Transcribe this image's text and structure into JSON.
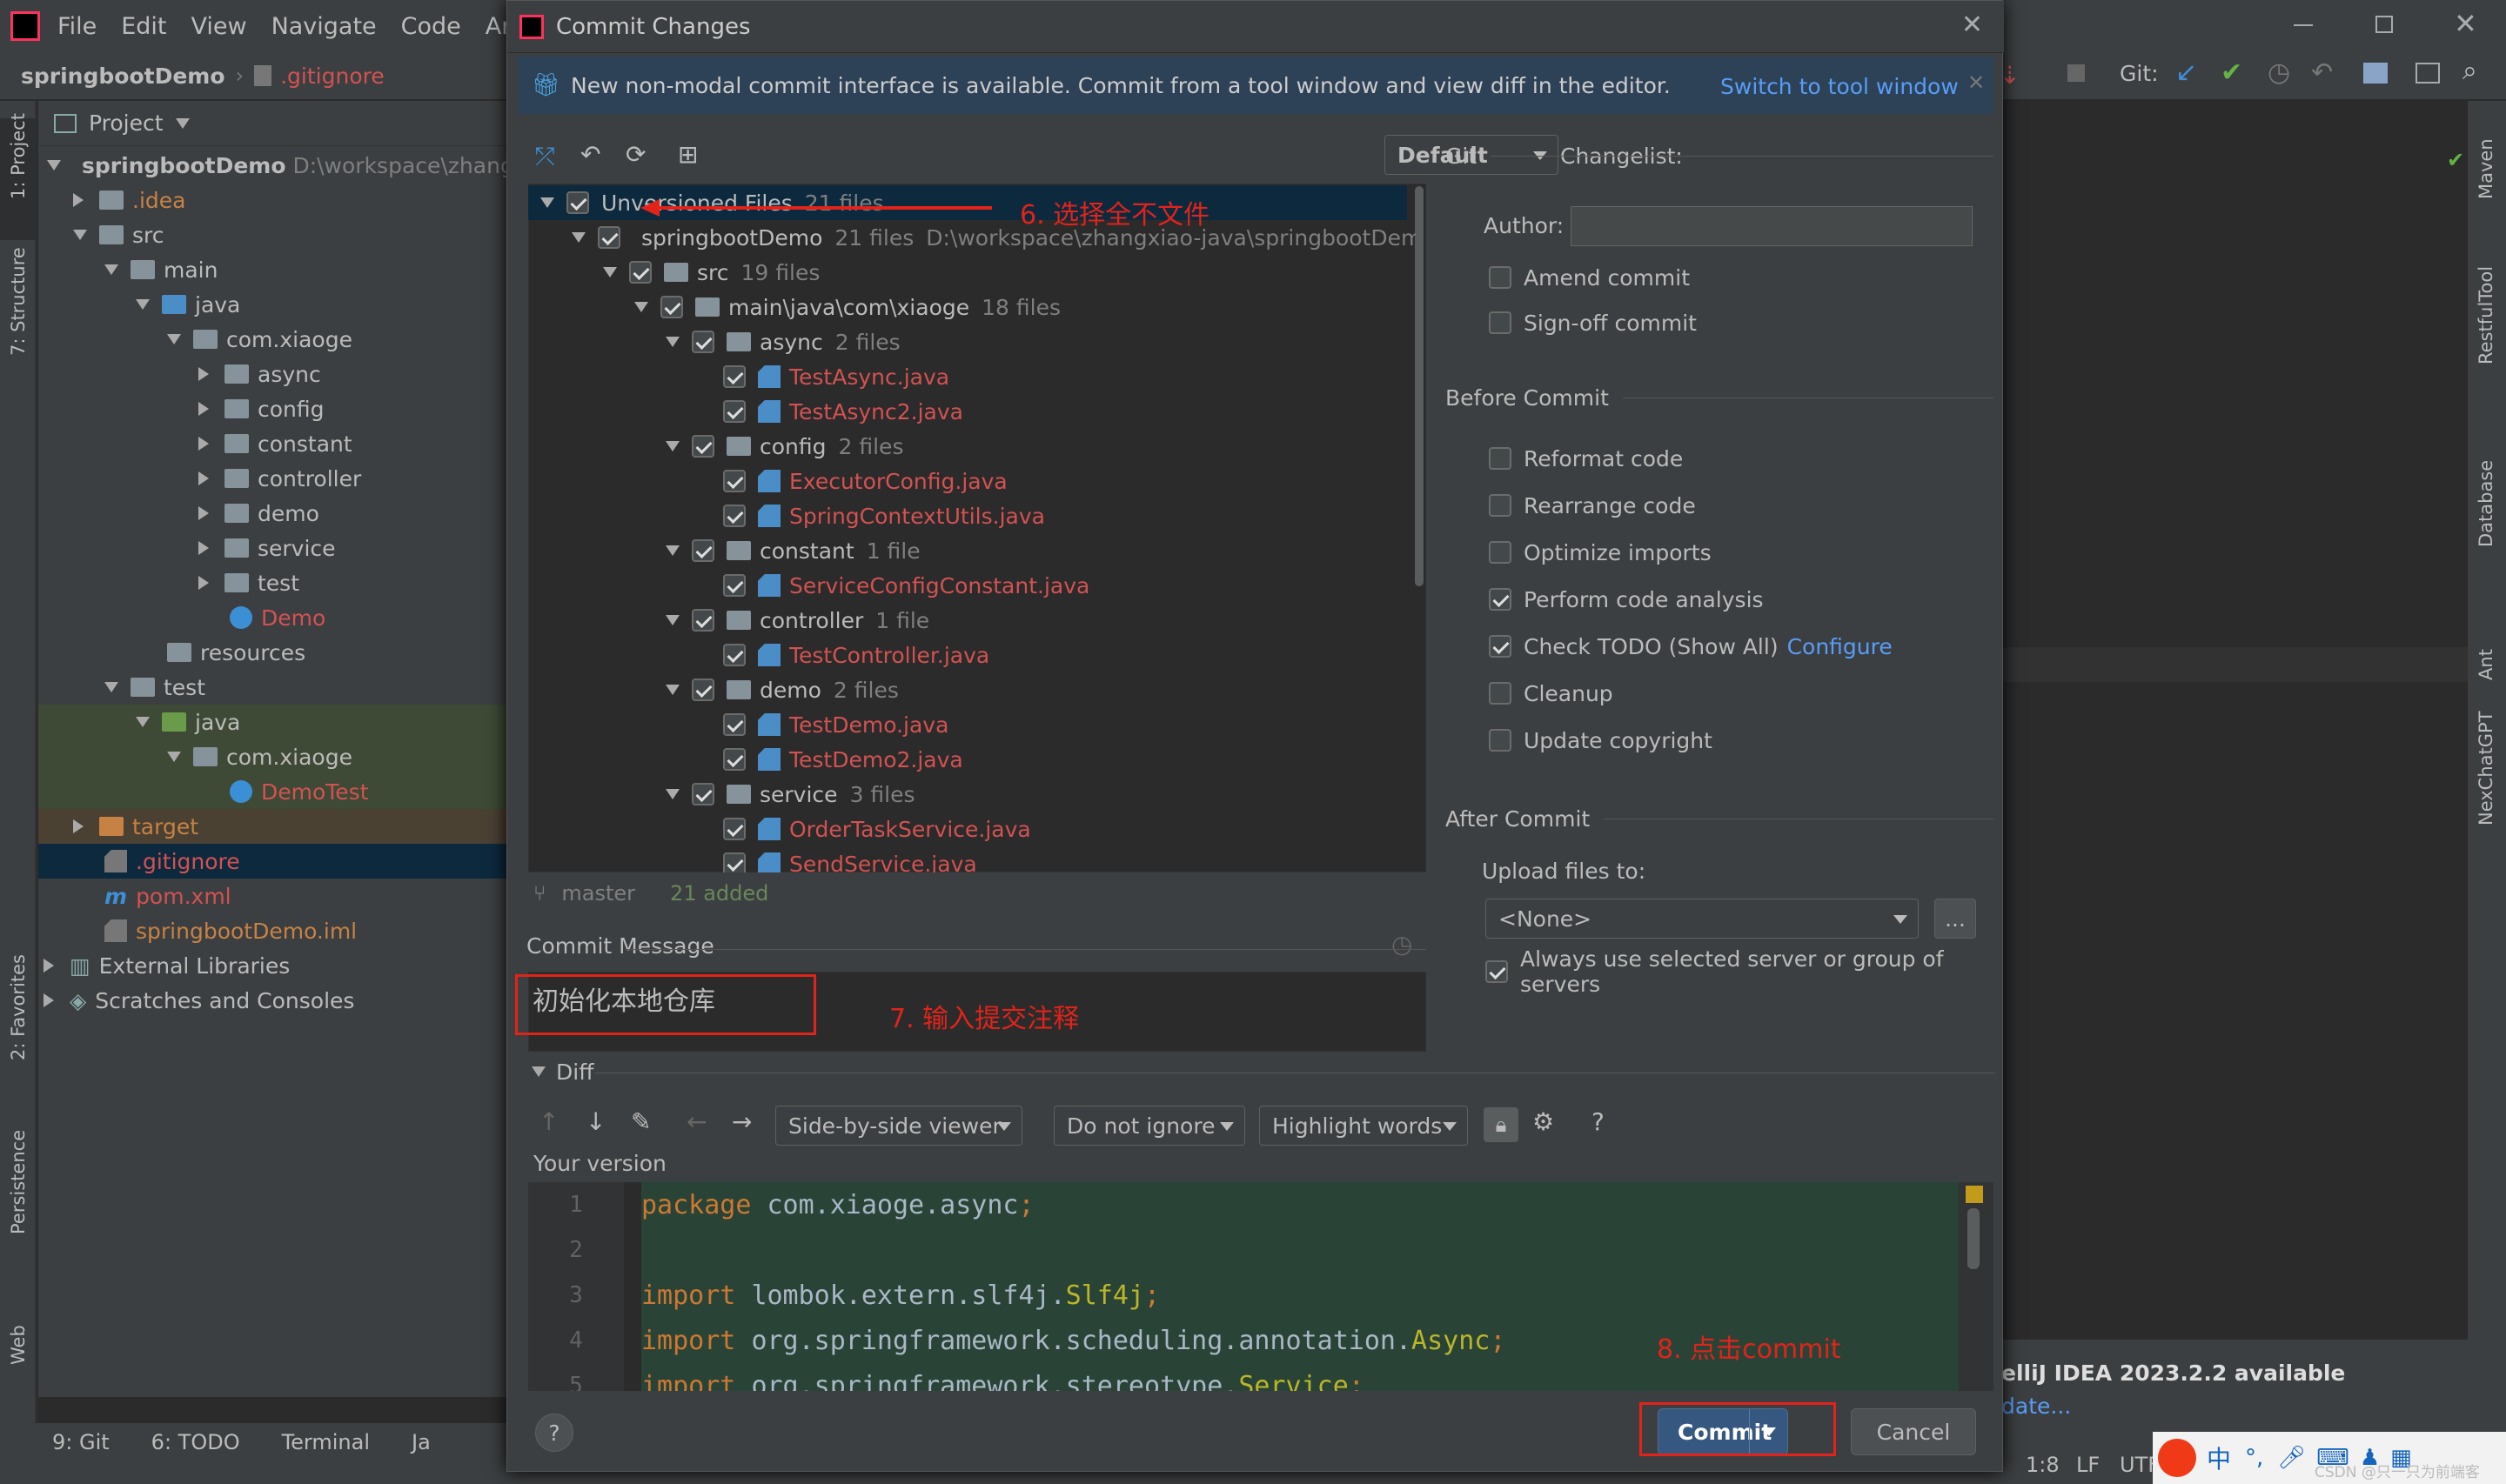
{
  "ide": {
    "menu": [
      "File",
      "Edit",
      "View",
      "Navigate",
      "Code",
      "Analyz"
    ],
    "breadcrumb_project": "springbootDemo",
    "breadcrumb_file": ".gitignore",
    "project_label": "Project",
    "git_label": "Git:",
    "left_tabs": [
      "1: Project",
      "7: Structure",
      "2: Favorites",
      "Persistence",
      "Web"
    ],
    "right_tabs": [
      "Maven",
      "RestfulTool",
      "Database",
      "Ant",
      "NexChatGPT"
    ],
    "tree": [
      {
        "label": "springbootDemo",
        "extra": "D:\\workspace\\zhang"
      },
      {
        "label": ".idea"
      },
      {
        "label": "src"
      },
      {
        "label": "main"
      },
      {
        "label": "java"
      },
      {
        "label": "com.xiaoge"
      },
      {
        "label": "async"
      },
      {
        "label": "config"
      },
      {
        "label": "constant"
      },
      {
        "label": "controller"
      },
      {
        "label": "demo"
      },
      {
        "label": "service"
      },
      {
        "label": "test"
      },
      {
        "label": "Demo"
      },
      {
        "label": "resources"
      },
      {
        "label": "test"
      },
      {
        "label": "java"
      },
      {
        "label": "com.xiaoge"
      },
      {
        "label": "DemoTest"
      },
      {
        "label": "target"
      },
      {
        "label": ".gitignore"
      },
      {
        "label": "pom.xml"
      },
      {
        "label": "springbootDemo.iml"
      },
      {
        "label": "External Libraries"
      },
      {
        "label": "Scratches and Consoles"
      }
    ],
    "bottom_tabs": [
      "9: Git",
      "6: TODO",
      "Terminal",
      "Ja"
    ],
    "notification_title": "elliJ IDEA 2023.2.2 available",
    "notification_link": "date...",
    "status_pos": "1:8",
    "status_lf": "LF",
    "status_enc": "UTF",
    "tray_text": "中",
    "watermark": "CSDN @只一只为前端客"
  },
  "dialog": {
    "title": "Commit Changes",
    "banner_text": "New non-modal commit interface is available. Commit from a tool window and view diff in the editor.",
    "banner_link": "Switch to tool window",
    "changelist_label": "Changelist:",
    "changelist_value": "Default",
    "files": [
      {
        "label": "Unversioned Files",
        "count": "21 files"
      },
      {
        "label": "springbootDemo",
        "count": "21 files",
        "path": "D:\\workspace\\zhangxiao-java\\springbootDemo"
      },
      {
        "label": "src",
        "count": "19 files"
      },
      {
        "label": "main\\java\\com\\xiaoge",
        "count": "18 files"
      },
      {
        "label": "async",
        "count": "2 files"
      },
      {
        "label": "TestAsync.java"
      },
      {
        "label": "TestAsync2.java"
      },
      {
        "label": "config",
        "count": "2 files"
      },
      {
        "label": "ExecutorConfig.java"
      },
      {
        "label": "SpringContextUtils.java"
      },
      {
        "label": "constant",
        "count": "1 file"
      },
      {
        "label": "ServiceConfigConstant.java"
      },
      {
        "label": "controller",
        "count": "1 file"
      },
      {
        "label": "TestController.java"
      },
      {
        "label": "demo",
        "count": "2 files"
      },
      {
        "label": "TestDemo.java"
      },
      {
        "label": "TestDemo2.java"
      },
      {
        "label": "service",
        "count": "3 files"
      },
      {
        "label": "OrderTaskService.java"
      },
      {
        "label": "SendService.java"
      }
    ],
    "branch": "master",
    "added": "21 added",
    "commit_message_label": "Commit Message",
    "commit_message": "初始化本地仓库",
    "diff_label": "Diff",
    "viewer": "Side-by-side viewer",
    "ignore": "Do not ignore",
    "highlight": "Highlight words",
    "your_version": "Your version",
    "code_lines": [
      {
        "n": "1",
        "parts": [
          [
            "kw",
            "package "
          ],
          [
            "",
            "com.xiaoge.async"
          ],
          [
            "kw",
            ";"
          ]
        ]
      },
      {
        "n": "2",
        "parts": []
      },
      {
        "n": "3",
        "parts": [
          [
            "kw",
            "import "
          ],
          [
            "",
            "lombok.extern.slf4j."
          ],
          [
            "ann",
            "Slf4j"
          ],
          [
            "kw",
            ";"
          ]
        ]
      },
      {
        "n": "4",
        "parts": [
          [
            "kw",
            "import "
          ],
          [
            "",
            "org.springframework.scheduling.annotation."
          ],
          [
            "ann",
            "Async"
          ],
          [
            "kw",
            ";"
          ]
        ]
      },
      {
        "n": "5",
        "parts": [
          [
            "kw",
            "import "
          ],
          [
            "",
            "org.springframework.stereotype."
          ],
          [
            "ann",
            "Service"
          ],
          [
            "kw",
            ";"
          ]
        ]
      }
    ],
    "git_section": "Git",
    "author_label": "Author:",
    "author_value": "",
    "amend": "Amend commit",
    "signoff": "Sign-off commit",
    "before_commit": "Before Commit",
    "options": [
      {
        "label": "Reformat code",
        "checked": false
      },
      {
        "label": "Rearrange code",
        "checked": false
      },
      {
        "label": "Optimize imports",
        "checked": false
      },
      {
        "label": "Perform code analysis",
        "checked": true
      },
      {
        "label": "Check TODO (Show All)",
        "checked": true,
        "link": "Configure"
      },
      {
        "label": "Cleanup",
        "checked": false
      },
      {
        "label": "Update copyright",
        "checked": false
      }
    ],
    "after_commit": "After Commit",
    "upload_label": "Upload files to:",
    "upload_value": "<None>",
    "browse": "...",
    "always_use": "Always use selected server or group of servers",
    "commit_button": "Commit",
    "cancel_button": "Cancel",
    "help": "?"
  },
  "annotations": {
    "a6": "6. 选择全不文件",
    "a7": "7. 输入提交注释",
    "a8": "8. 点击commit"
  },
  "colors": {
    "accent_link": "#589df6",
    "annotation_red": "#e2231a",
    "commit_blue": "#365880",
    "unversioned_red": "#d25252"
  }
}
